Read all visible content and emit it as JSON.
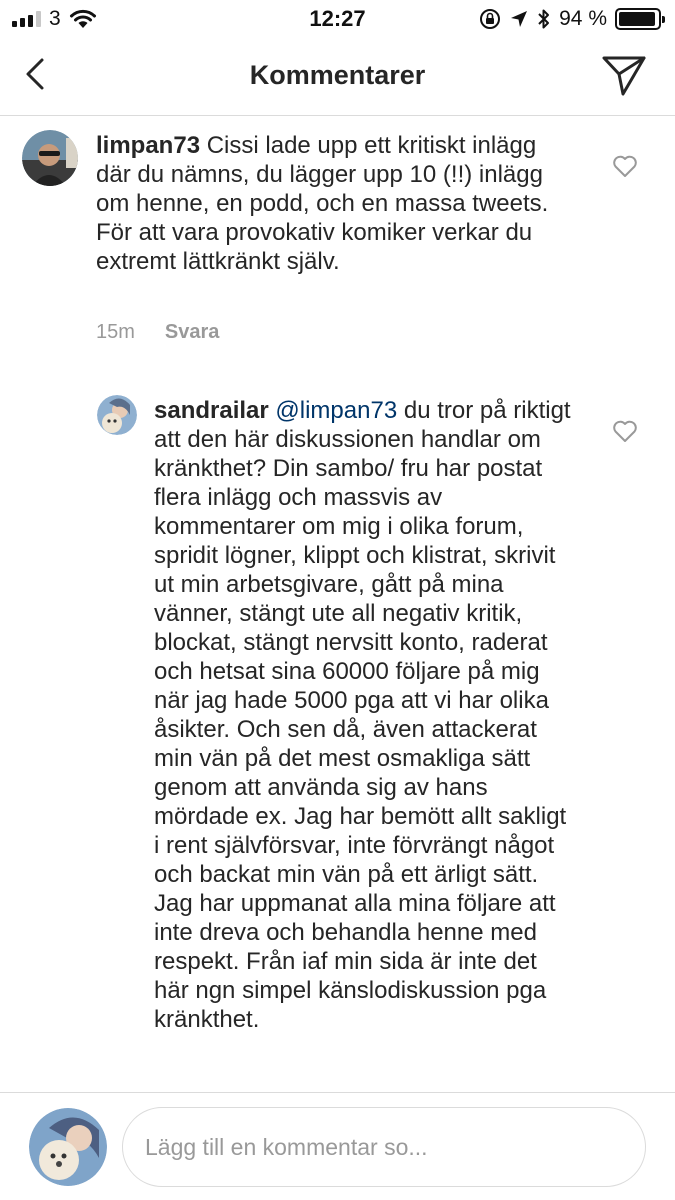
{
  "status_bar": {
    "carrier": "3",
    "time": "12:27",
    "battery_percent": "94 %",
    "battery_level": 0.94,
    "signal_bars_filled": 3,
    "signal_bars_total": 4
  },
  "header": {
    "title": "Kommentarer"
  },
  "comments": [
    {
      "username": "limpan73",
      "mention": "",
      "text": "Cissi lade upp ett kritiskt inlägg där du nämns, du lägger upp 10 (!!) inlägg om henne, en podd, och en massa tweets. För att vara provokativ komiker verkar du extremt lättkränkt själv.",
      "time": "15m",
      "reply_label": "Svara"
    },
    {
      "username": "sandrailar",
      "mention": "@limpan73",
      "text": "du tror på riktigt att den här diskussionen handlar om kränkthet? Din sambo/ fru har postat flera inlägg och massvis av kommentarer om mig i olika forum, spridit lögner, klippt och klistrat, skrivit ut min arbetsgivare, gått på mina vänner, stängt ute all negativ kritik, blockat, stängt nervsitt konto, raderat och hetsat sina 60000 följare på mig när jag hade 5000 pga att vi har olika åsikter. Och sen då, även attackerat min vän på det mest osmakliga sätt genom att använda sig av hans mördade ex. Jag har bemött allt sakligt i rent självförsvar, inte förvrängt något och backat min vän på ett ärligt sätt. Jag har uppmanat alla mina följare att inte dreva och behandla henne med respekt. Från iaf min sida är inte det här ngn simpel känslodiskussion pga kränkthet."
    }
  ],
  "input": {
    "placeholder": "Lägg till en kommentar so..."
  },
  "colors": {
    "text": "#262626",
    "secondary": "#999999",
    "mention": "#003569",
    "divider": "#dbdbdb"
  },
  "icons": [
    "chevron-left-icon",
    "direct-send-icon",
    "heart-outline-icon",
    "wifi-icon",
    "bluetooth-icon",
    "location-arrow-icon",
    "orientation-lock-icon"
  ]
}
